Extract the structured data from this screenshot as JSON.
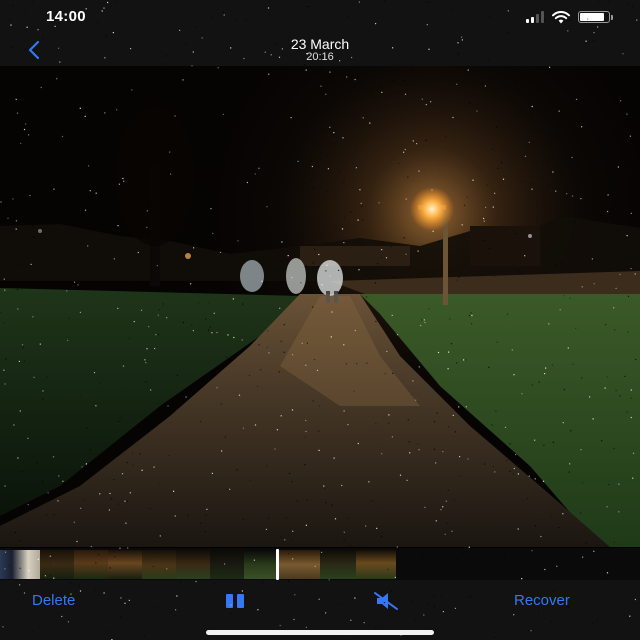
{
  "status_bar": {
    "time": "14:00",
    "signal_bars_filled": 2,
    "signal_bars_total": 4,
    "battery_level": 0.85,
    "icons": [
      "cellular-signal-icon",
      "wifi-icon",
      "battery-icon"
    ]
  },
  "nav": {
    "back_icon": "chevron-left-icon",
    "title": "23 March",
    "subtitle": "20:16"
  },
  "colors": {
    "accent": "#3478f6",
    "bar_background": "#121212",
    "streetlight": "#ffb347"
  },
  "toolbar": {
    "delete_label": "Delete",
    "recover_label": "Recover",
    "pause_icon": "pause-icon",
    "mute_icon": "speaker-muted-icon"
  },
  "filmstrip": {
    "thumbnail_count": 12
  }
}
